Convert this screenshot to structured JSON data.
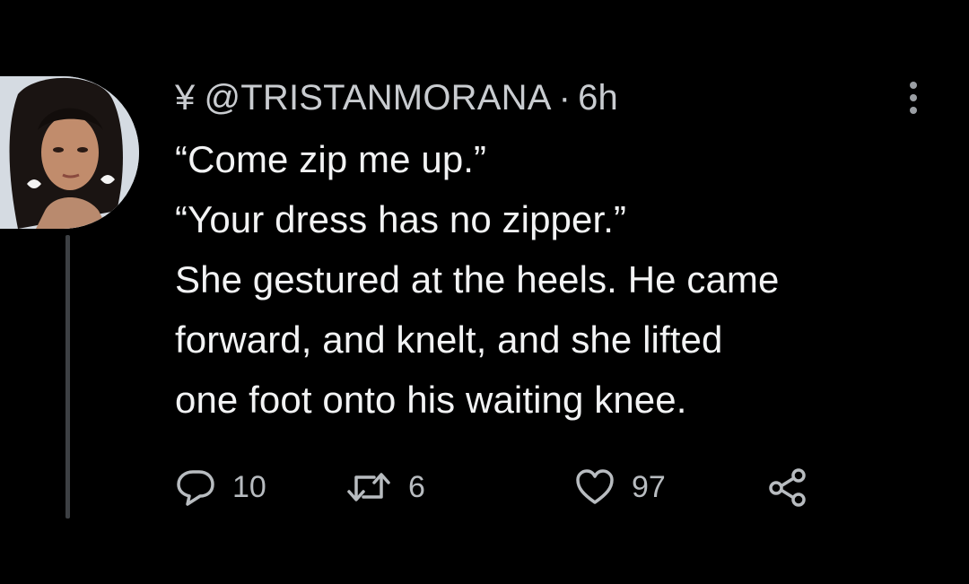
{
  "tweet": {
    "author_symbol": "¥",
    "handle": "@TRISTANMORANA",
    "separator": "·",
    "time": "6h",
    "text_lines": [
      "“Come zip me up.”",
      "“Your dress has no zipper.”",
      "She gestured at the heels. He came",
      "forward, and knelt, and she lifted",
      "one foot onto his waiting knee."
    ],
    "stats": {
      "replies": "10",
      "retweets": "6",
      "likes": "97"
    }
  },
  "icons": {
    "more": "more-vertical-icon",
    "reply": "reply-icon",
    "retweet": "retweet-icon",
    "like": "heart-icon",
    "share": "share-icon"
  },
  "colors": {
    "background": "#000000",
    "text": "#f2f3f4",
    "muted": "#b8bcc0",
    "thread_line": "#3d4044"
  }
}
